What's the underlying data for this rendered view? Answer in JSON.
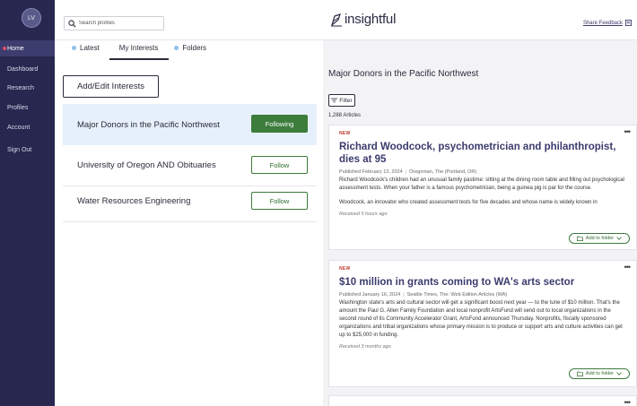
{
  "sidebar": {
    "avatar": "LV",
    "items": [
      {
        "label": "Home"
      },
      {
        "label": "Dashboard"
      },
      {
        "label": "Research"
      },
      {
        "label": "Profiles"
      },
      {
        "label": "Account"
      },
      {
        "label": "Sign Out"
      }
    ],
    "active_index": 0,
    "accent": "#e24d6b"
  },
  "header": {
    "search_placeholder": "Search profiles",
    "logo_text": "insightful",
    "share_feedback": "Share Feedback"
  },
  "tabs": [
    {
      "label": "Latest"
    },
    {
      "label": "My Interests"
    },
    {
      "label": "Folders"
    }
  ],
  "interests": {
    "add_button": "Add/Edit Interests",
    "items": [
      {
        "name": "Major Donors in the Pacific Northwest",
        "button": "Following"
      },
      {
        "name": "University of Oregon AND Obituaries",
        "button": "Follow"
      },
      {
        "name": "Water Resources Engineering",
        "button": "Follow"
      }
    ]
  },
  "feed": {
    "title": "Major Donors in the Pacific Northwest",
    "filter_label": "Filter",
    "count": "1,288 Articles",
    "articles": [
      {
        "badge": "NEW",
        "more": "•••",
        "title": "Richard Woodcock, psychometrician and philanthropist, dies at 95",
        "published": "Published February 13, 2024",
        "source": "Oregonian, The (Portland, OR)",
        "body": "Richard Woodcock's children had an unusual family pastime: sitting at the dining room table and filling out psychological assessment tests. When your father is a famous psychometrician, being a guinea pig is par for the course.",
        "body2": "Woodcock, an innovator who created assessment tests for five decades and whose name is widely known in",
        "received": "Received 5 hours ago",
        "folder_button": "Add to folder"
      },
      {
        "badge": "NEW",
        "more": "•••",
        "title": "$10 million in grants coming to WA's arts sector",
        "published": "Published January 16, 2024",
        "source": "Seattle Times, The: Web Edition Articles (WA)",
        "body": "Washington state's arts and cultural sector will get a significant boost next year — to the tune of $10 million. That's the amount the Paul G. Allen Family Foundation and local nonprofit ArtsFund will send out to local organizations in the second round of its Community Accelerator Grant, ArtsFund announced Thursday. Nonprofits, fiscally sponsored organizations and tribal organizations whose primary mission is to produce or support arts and culture activities can get up to $25,000 in funding.",
        "received": "Received 3 months ago",
        "folder_button": "Add to folder"
      },
      {
        "more": "•••"
      }
    ]
  }
}
